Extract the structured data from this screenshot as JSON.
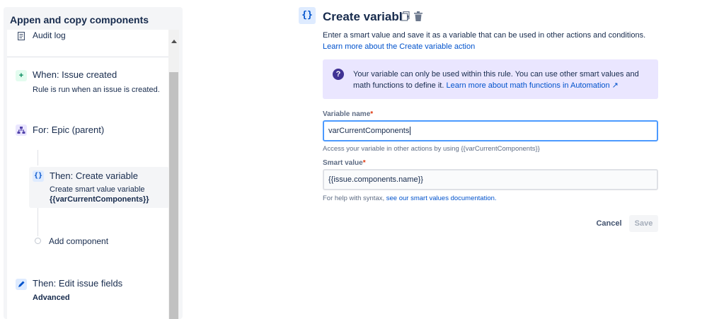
{
  "sidebar": {
    "title": "Appen and copy components",
    "items": {
      "audit": {
        "label": "Audit log",
        "icon": "document-icon"
      },
      "trigger": {
        "title": "When: Issue created",
        "subtitle": "Rule is run when an issue is created.",
        "icon": "plus-icon"
      },
      "branch": {
        "title": "For: Epic (parent)",
        "icon": "branch-icon"
      },
      "action_var": {
        "title": "Then: Create variable",
        "subtitle": "Create smart value variable",
        "variable": "{{varCurrentComponents}}",
        "icon": "braces-icon"
      },
      "add": {
        "label": "Add component"
      },
      "edit": {
        "title": "Then: Edit issue fields",
        "subtitle": "Advanced",
        "icon": "pencil-icon"
      }
    }
  },
  "main": {
    "icon_text": "{}",
    "title": "Create variable",
    "description": "Enter a smart value and save it as a variable that can be used in other actions and conditions.",
    "description_link": "Learn more about the Create variable action",
    "info": {
      "text": "Your variable can only be used within this rule. You can use other smart values and math functions to define it.",
      "link": "Learn more about math functions in Automation ↗"
    },
    "variable_name": {
      "label": "Variable name",
      "value": "varCurrentComponents",
      "help": "Access your variable in other actions by using {{varCurrentComponents}}"
    },
    "smart_value": {
      "label": "Smart value",
      "value": "{{issue.components.name}}",
      "help_prefix": "For help with syntax,",
      "help_link": "see our smart values documentation."
    },
    "buttons": {
      "cancel": "Cancel",
      "save": "Save"
    }
  },
  "colors": {
    "link": "#0052cc",
    "info_bg": "#eae6ff",
    "focus_border": "#4c9aff",
    "trigger_green": "#00875a",
    "branch_purple": "#5243aa"
  }
}
